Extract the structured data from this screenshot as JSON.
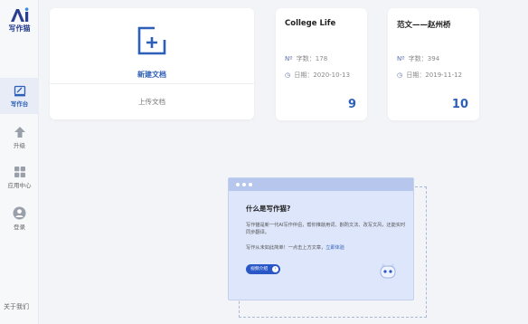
{
  "app": {
    "name": "写作猫",
    "brand_color": "#2d5fb8"
  },
  "sidebar": {
    "items": [
      {
        "label": "写作台",
        "icon": "writing-desk-icon",
        "active": true
      },
      {
        "label": "升级",
        "icon": "upgrade-arrow-icon",
        "active": false
      },
      {
        "label": "应用中心",
        "icon": "apps-grid-icon",
        "active": false
      },
      {
        "label": "登录",
        "icon": "user-avatar-icon",
        "active": false
      }
    ],
    "about": "关于我们"
  },
  "new_doc": {
    "label": "新建文档",
    "upload": "上传文档",
    "icon": "new-document-icon"
  },
  "documents": [
    {
      "title": "College Life",
      "words_label": "字数：",
      "words": "178",
      "date_label": "日期：",
      "date": "2020-10-13",
      "count": "9"
    },
    {
      "title": "范文——赵州桥",
      "words_label": "字数：",
      "words": "394",
      "date_label": "日期：",
      "date": "2019-11-12",
      "count": "10"
    }
  ],
  "help_panel": {
    "title": "什么是写作猫?",
    "description": "写作猫是新一代AI写作伴侣，帮你推敲用词、斟酌文法、改写文风，还能实时同步翻译。",
    "hint": "写作从未如此简单！一点击上方文章，",
    "hint_link": "立即体验",
    "button_label": "视频介绍",
    "button_icon": "arrow-right-icon",
    "bot_icon": "cat-bot-icon"
  }
}
